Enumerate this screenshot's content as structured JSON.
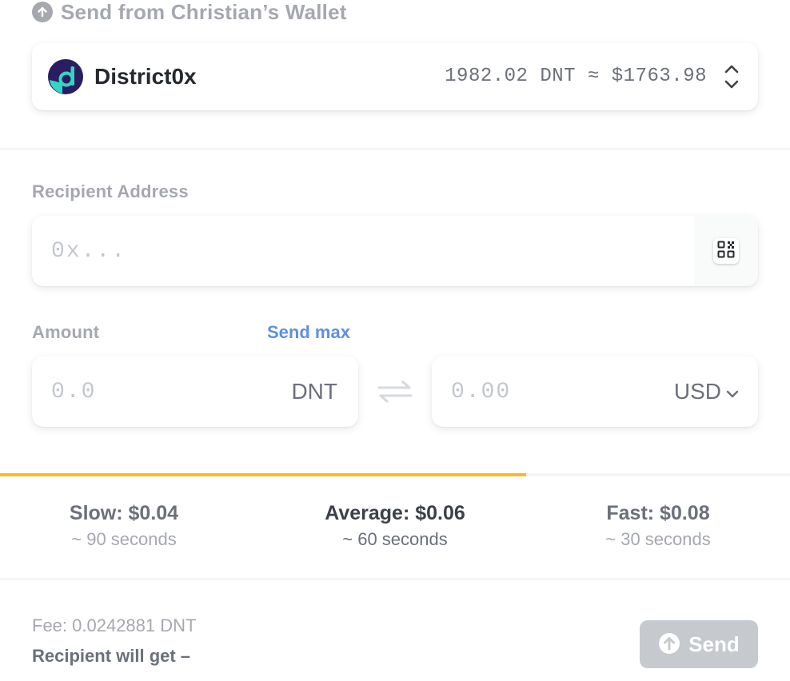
{
  "header": {
    "icon": "arrow-up-circle-icon",
    "title": "Send from Christian’s Wallet"
  },
  "token": {
    "name": "District0x",
    "logo": "district0x-logo",
    "balance": "1982.02 DNT ≈ $1763.98",
    "selector_icon": "chevron-up-down-icon"
  },
  "recipient": {
    "label": "Recipient Address",
    "placeholder": "0x...",
    "value": "",
    "qr_icon": "qr-code-icon"
  },
  "amount": {
    "label": "Amount",
    "send_max": "Send max",
    "token_placeholder": "0.0",
    "token_unit": "DNT",
    "fiat_placeholder": "0.00",
    "fiat_currency": "USD",
    "swap_icon": "swap-arrows-icon"
  },
  "gas": {
    "progress": 0.666,
    "accent": "#ffb627",
    "options": [
      {
        "price": "Slow: $0.04",
        "time": "~ 90 seconds"
      },
      {
        "price": "Average: $0.06",
        "time": "~ 60 seconds"
      },
      {
        "price": "Fast: $0.08",
        "time": "~ 30 seconds"
      }
    ],
    "selected": "Average"
  },
  "footer": {
    "fee": "Fee: 0.0242881 DNT",
    "recipient_gets": "Recipient will get –",
    "send_label": "Send",
    "send_icon": "arrow-up-circle-icon"
  },
  "colors": {
    "link": "#5e8fe6",
    "muted": "#a5a8ae",
    "button_disabled": "#c6c9ce"
  }
}
